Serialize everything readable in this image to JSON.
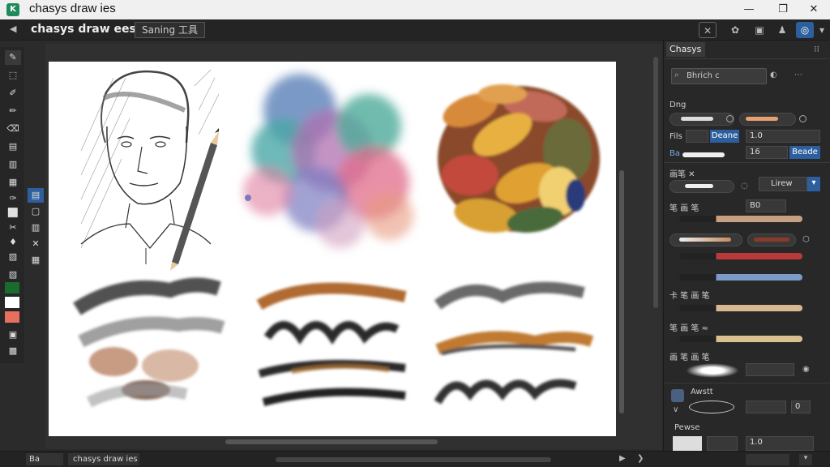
{
  "window": {
    "title": "chasys draw ies"
  },
  "toolbar": {
    "back_glyph": "◀",
    "app_name": "chasys draw ees",
    "tab_label": "Saning 工具"
  },
  "toolbar_right": [
    "✕",
    "✿",
    "▣",
    "♟",
    "◎",
    "▾"
  ],
  "left_tools": [
    "✎",
    "⬚",
    "✐",
    "✏",
    "⌫",
    "▤",
    "▥",
    "▦",
    "✑",
    "⬜",
    "✂",
    "♦",
    "▧",
    "▨",
    "▣",
    "▩",
    "▤",
    "▥"
  ],
  "sub_tools": [
    "▤",
    "▢",
    "▥",
    "✕",
    "▦"
  ],
  "colors": {
    "fg": "#1a6b2e",
    "bg": "#ffffff",
    "accent": "#e67060"
  },
  "panel": {
    "tab": "Chasys",
    "search_placeholder": "Bhrich c",
    "sections": {
      "brush_label": "Dng",
      "size_label": "Fils",
      "size_button": "Deane",
      "size_value": "1.0",
      "row2_label": "Ba",
      "row2_value": "16",
      "row2_button": "Beade",
      "row3_label": "画笔 ✕",
      "dropdown": "Lirew",
      "row4_label": "笔 画 笔",
      "row4_value": "B0",
      "list_labels": [
        "卡 笔 画 笔",
        "笔 画 笔 ≈",
        "画 笔 画 笔"
      ],
      "bottom_label": "Awstt",
      "bottom_value": "0",
      "footer_label": "Pewse",
      "footer_value": "1.0"
    }
  },
  "statusbar": {
    "left": "Ba",
    "doc": "chasys draw ies"
  }
}
